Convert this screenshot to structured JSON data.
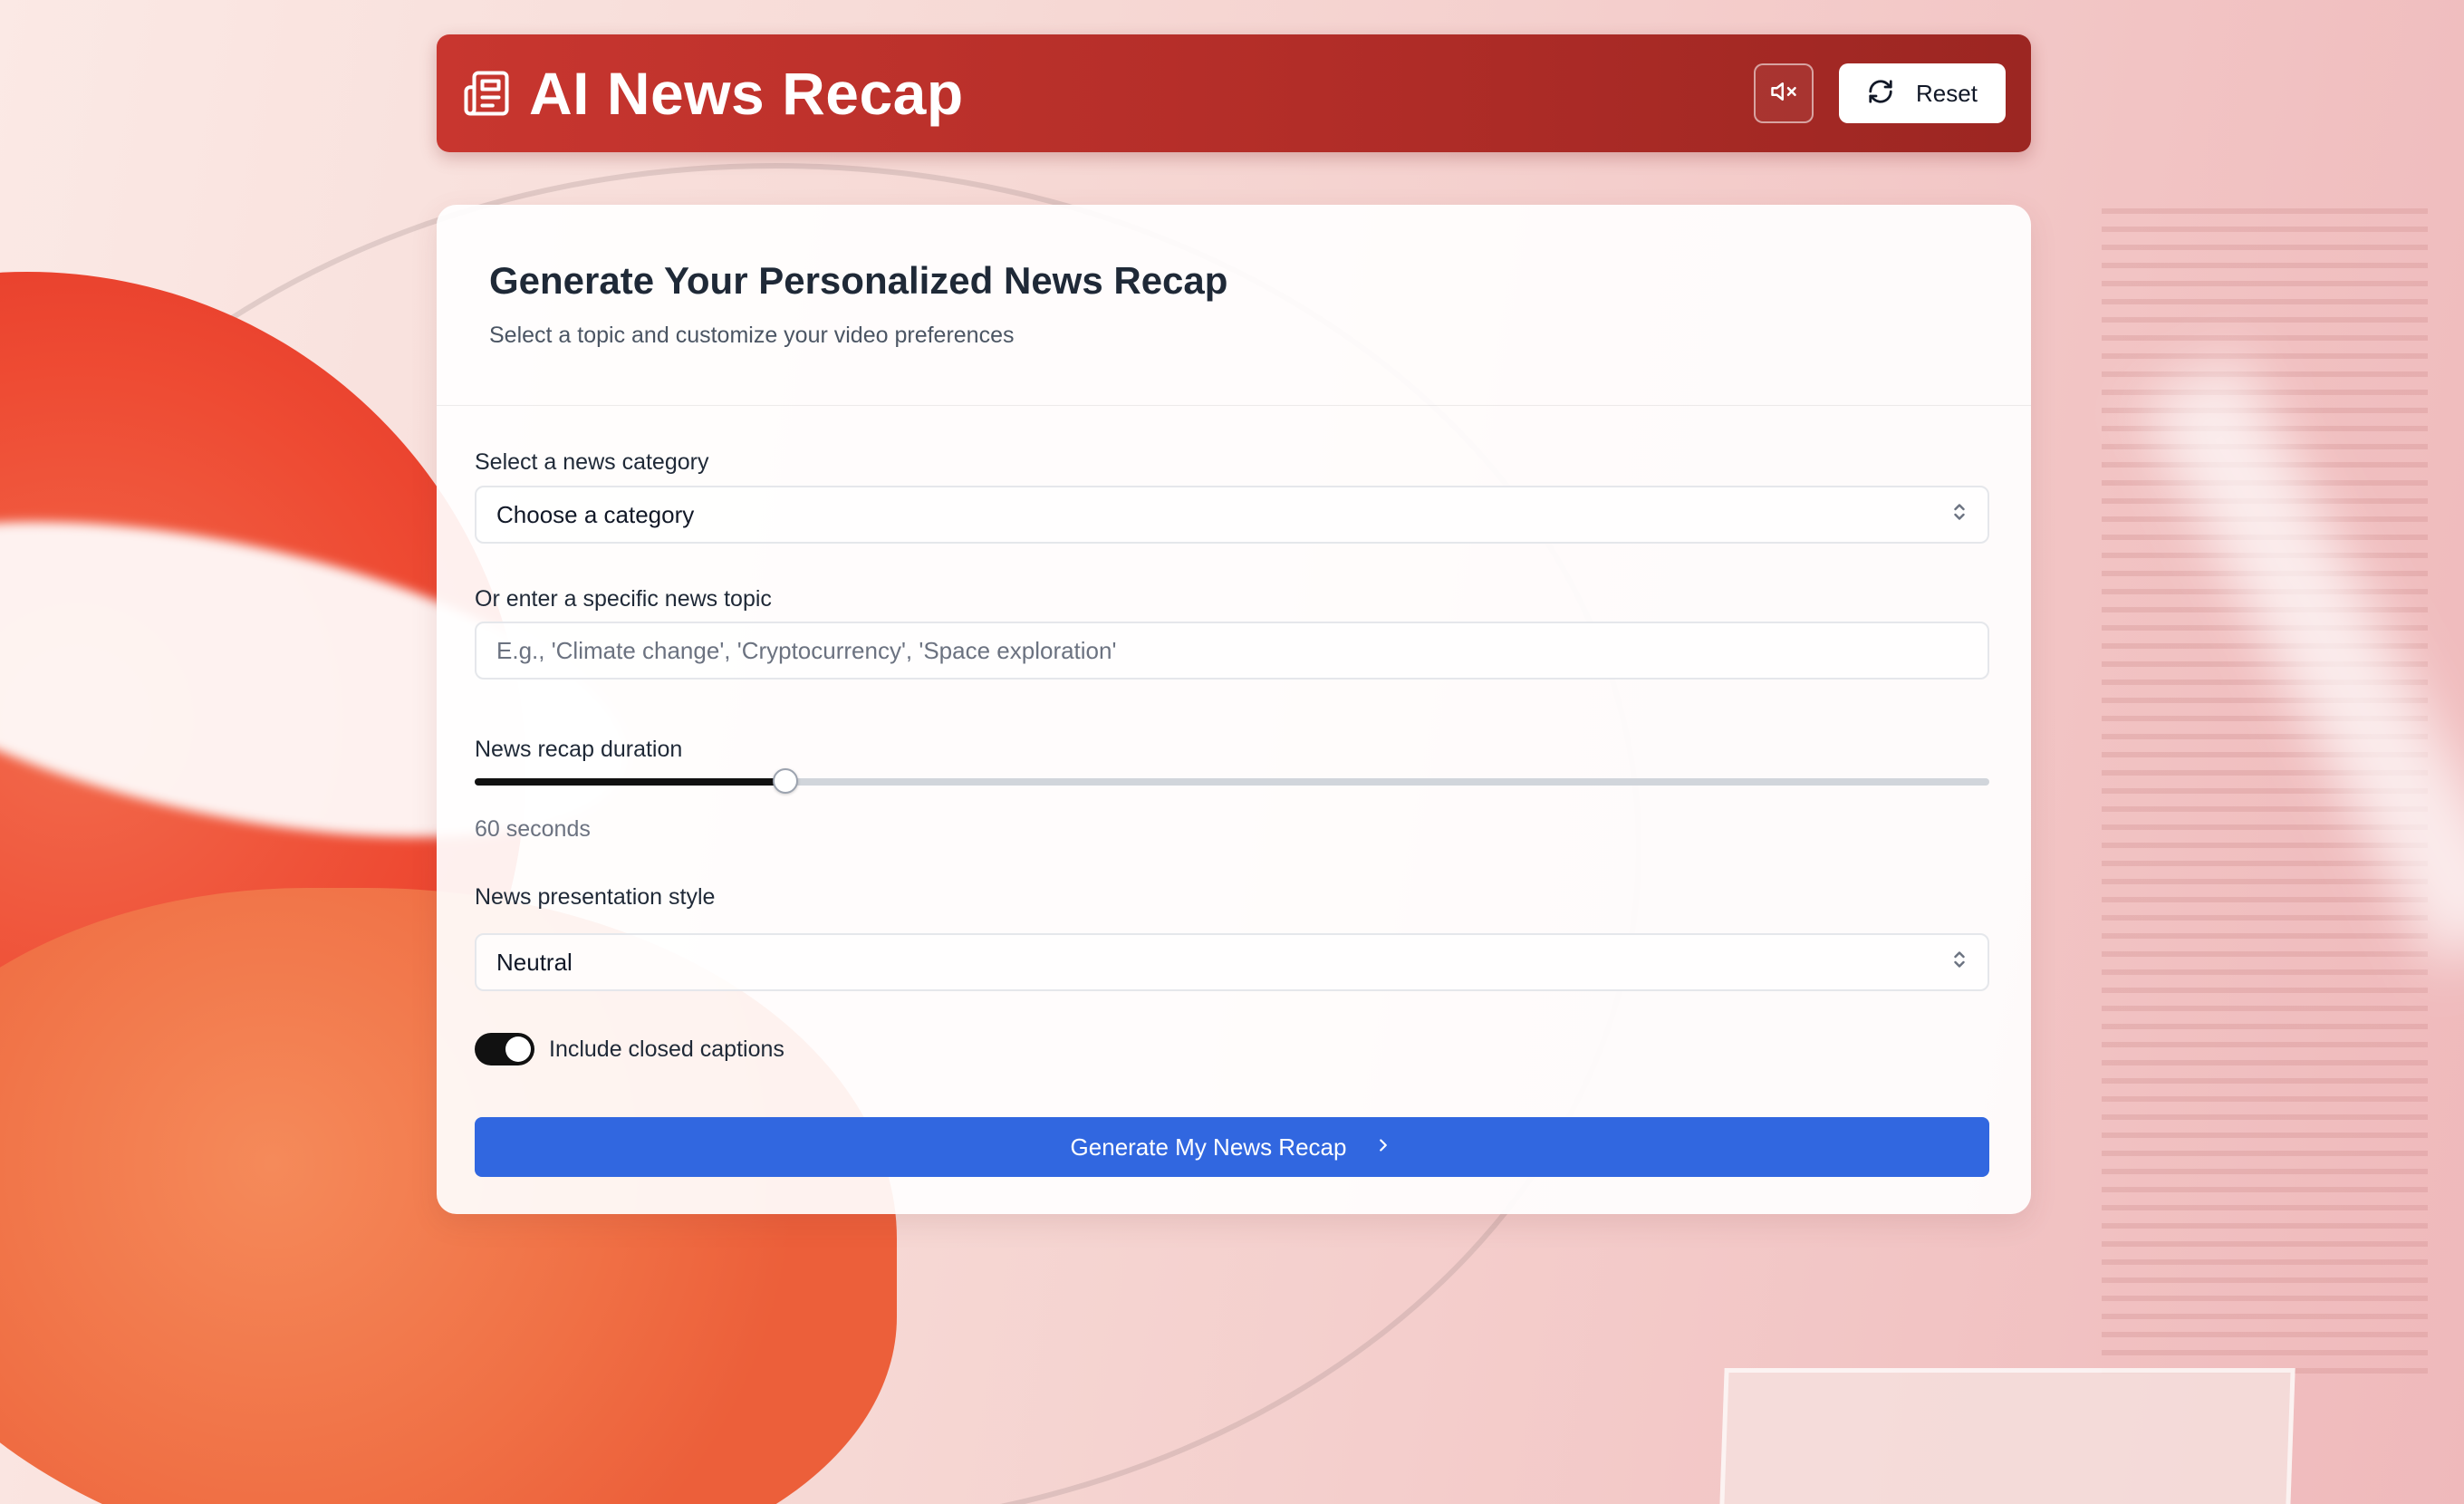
{
  "app": {
    "title": "AI News Recap"
  },
  "header": {
    "mute_icon": "volume-mute-icon",
    "reset_label": "Reset",
    "reset_icon": "refresh-icon"
  },
  "card": {
    "title": "Generate Your Personalized News Recap",
    "subtitle": "Select a topic and customize your video preferences"
  },
  "form": {
    "category": {
      "label": "Select a news category",
      "selected": "Choose a category"
    },
    "topic": {
      "label": "Or enter a specific news topic",
      "value": "",
      "placeholder": "E.g., 'Climate change', 'Cryptocurrency', 'Space exploration'"
    },
    "duration": {
      "label": "News recap duration",
      "value_text": "60 seconds",
      "fraction": 0.205
    },
    "style": {
      "label": "News presentation style",
      "selected": "Neutral"
    },
    "captions": {
      "label": "Include closed captions",
      "enabled": true
    },
    "submit_label": "Generate My News Recap"
  },
  "colors": {
    "header_red": "#b22d28",
    "primary_blue": "#3167e0",
    "toggle_on": "#111111"
  }
}
